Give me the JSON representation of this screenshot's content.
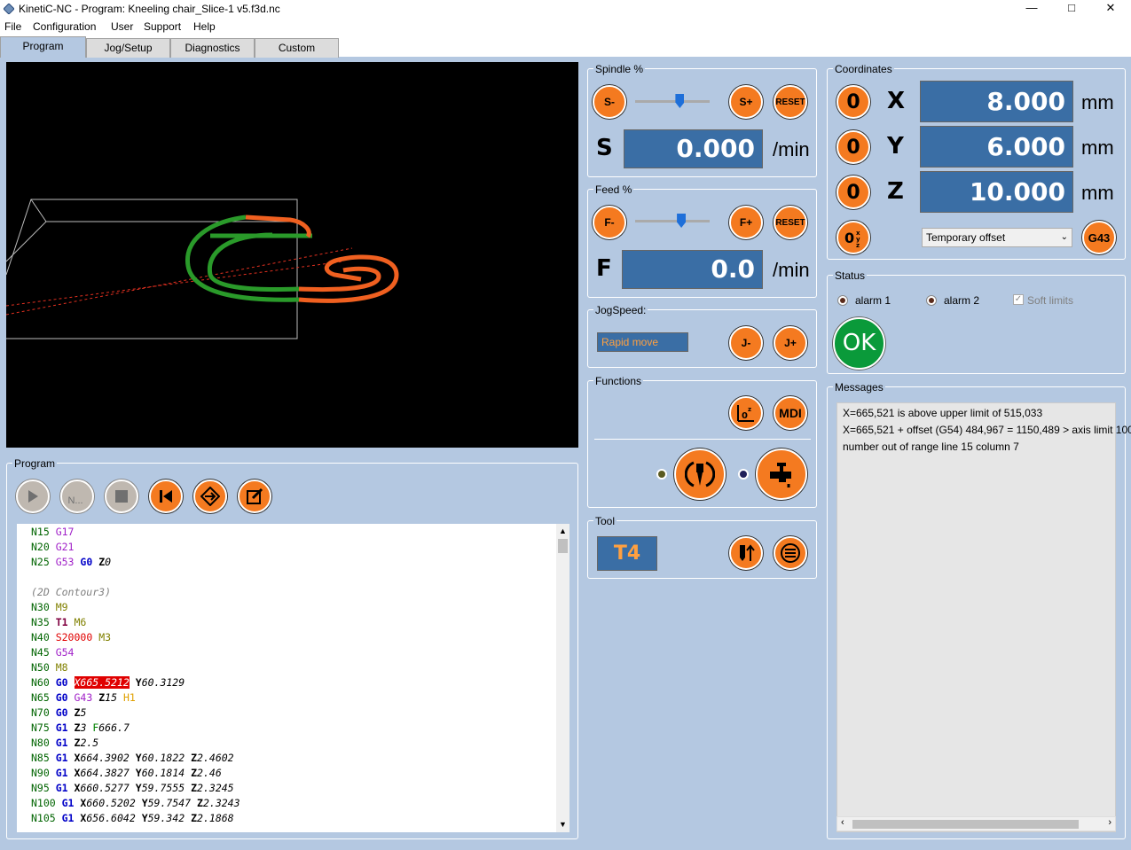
{
  "window": {
    "title": "KinetiC-NC - Program: Kneeling chair_Slice-1 v5.f3d.nc",
    "minimize": "—",
    "maximize": "□",
    "close": "✕"
  },
  "menu": [
    "File",
    "Configuration",
    "User",
    "Support",
    "Help"
  ],
  "tabs": [
    "Program",
    "Jog/Setup",
    "Diagnostics",
    "Custom"
  ],
  "spindle": {
    "label": "Spindle %",
    "minus": "S-",
    "plus": "S+",
    "reset": "RESET",
    "letter": "S",
    "value": "0.000",
    "unit": "/min",
    "slider_fraction": 0.6
  },
  "feed": {
    "label": "Feed %",
    "minus": "F-",
    "plus": "F+",
    "reset": "RESET",
    "letter": "F",
    "value": "0.0",
    "unit": "/min",
    "slider_fraction": 0.62
  },
  "jog": {
    "label": "JogSpeed:",
    "mode": "Rapid move",
    "minus": "J-",
    "plus": "J+"
  },
  "functions": {
    "label": "Functions",
    "mdi": "MDI"
  },
  "tool": {
    "label": "Tool",
    "value": "T4"
  },
  "coordinates": {
    "label": "Coordinates",
    "zero": "0",
    "axes": [
      {
        "name": "X",
        "value": "8.000",
        "unit": "mm"
      },
      {
        "name": "Y",
        "value": "6.000",
        "unit": "mm"
      },
      {
        "name": "Z",
        "value": "10.000",
        "unit": "mm"
      }
    ],
    "offset_select": "Temporary offset",
    "g43": "G43"
  },
  "status": {
    "label": "Status",
    "alarm1": "alarm 1",
    "alarm2": "alarm 2",
    "soft_limits": "Soft limits",
    "ok": "OK"
  },
  "messages": {
    "label": "Messages",
    "lines": [
      "X=665,521 is above upper limit of 515,033",
      "X=665,521 + offset (G54) 484,967 = 1150,489 > axis limit 100",
      "number out of range line 15 column 7"
    ]
  },
  "program": {
    "label": "Program",
    "next_label": "N..."
  },
  "code": [
    [
      [
        "N15 ",
        "n"
      ],
      [
        "G17",
        "g"
      ]
    ],
    [
      [
        "N20 ",
        "n"
      ],
      [
        "G21",
        "g"
      ]
    ],
    [
      [
        "N25 ",
        "n"
      ],
      [
        "G53",
        "g"
      ],
      [
        " ",
        "t"
      ],
      [
        "G0",
        "b"
      ],
      [
        " ",
        "t"
      ],
      [
        "Z",
        "k"
      ],
      [
        "0",
        "i"
      ]
    ],
    [],
    [
      [
        "(2D Contour3)",
        "c"
      ]
    ],
    [
      [
        "N30 ",
        "n"
      ],
      [
        "M9",
        "m"
      ]
    ],
    [
      [
        "N35 ",
        "n"
      ],
      [
        "T1",
        "r"
      ],
      [
        " ",
        "t"
      ],
      [
        "M6",
        "m"
      ]
    ],
    [
      [
        "N40 ",
        "n"
      ],
      [
        "S20000",
        "s"
      ],
      [
        " ",
        "t"
      ],
      [
        "M3",
        "m"
      ]
    ],
    [
      [
        "N45 ",
        "n"
      ],
      [
        "G54",
        "g"
      ]
    ],
    [
      [
        "N50 ",
        "n"
      ],
      [
        "M8",
        "m"
      ]
    ],
    [
      [
        "N60 ",
        "n"
      ],
      [
        "G0",
        "b"
      ],
      [
        " ",
        "t"
      ],
      [
        "X665.5212",
        "e"
      ],
      [
        " ",
        "t"
      ],
      [
        "Y",
        "k"
      ],
      [
        "60.3129",
        "i"
      ]
    ],
    [
      [
        "N65 ",
        "n"
      ],
      [
        "G0",
        "b"
      ],
      [
        " ",
        "t"
      ],
      [
        "G43",
        "g"
      ],
      [
        " ",
        "t"
      ],
      [
        "Z",
        "k"
      ],
      [
        "15",
        "i"
      ],
      [
        " ",
        "t"
      ],
      [
        "H1",
        "h"
      ]
    ],
    [
      [
        "N70 ",
        "n"
      ],
      [
        "G0",
        "b"
      ],
      [
        " ",
        "t"
      ],
      [
        "Z",
        "k"
      ],
      [
        "5",
        "i"
      ]
    ],
    [
      [
        "N75 ",
        "n"
      ],
      [
        "G1",
        "b"
      ],
      [
        " ",
        "t"
      ],
      [
        "Z",
        "k"
      ],
      [
        "3",
        "i"
      ],
      [
        " ",
        "t"
      ],
      [
        "F",
        "f"
      ],
      [
        "666.7",
        "i"
      ]
    ],
    [
      [
        "N80 ",
        "n"
      ],
      [
        "G1",
        "b"
      ],
      [
        " ",
        "t"
      ],
      [
        "Z",
        "k"
      ],
      [
        "2.5",
        "i"
      ]
    ],
    [
      [
        "N85 ",
        "n"
      ],
      [
        "G1",
        "b"
      ],
      [
        " ",
        "t"
      ],
      [
        "X",
        "k"
      ],
      [
        "664.3902",
        "i"
      ],
      [
        " ",
        "t"
      ],
      [
        "Y",
        "k"
      ],
      [
        "60.1822",
        "i"
      ],
      [
        " ",
        "t"
      ],
      [
        "Z",
        "k"
      ],
      [
        "2.4602",
        "i"
      ]
    ],
    [
      [
        "N90 ",
        "n"
      ],
      [
        "G1",
        "b"
      ],
      [
        " ",
        "t"
      ],
      [
        "X",
        "k"
      ],
      [
        "664.3827",
        "i"
      ],
      [
        " ",
        "t"
      ],
      [
        "Y",
        "k"
      ],
      [
        "60.1814",
        "i"
      ],
      [
        " ",
        "t"
      ],
      [
        "Z",
        "k"
      ],
      [
        "2.46",
        "i"
      ]
    ],
    [
      [
        "N95 ",
        "n"
      ],
      [
        "G1",
        "b"
      ],
      [
        " ",
        "t"
      ],
      [
        "X",
        "k"
      ],
      [
        "660.5277",
        "i"
      ],
      [
        " ",
        "t"
      ],
      [
        "Y",
        "k"
      ],
      [
        "59.7555",
        "i"
      ],
      [
        " ",
        "t"
      ],
      [
        "Z",
        "k"
      ],
      [
        "2.3245",
        "i"
      ]
    ],
    [
      [
        "N100 ",
        "n"
      ],
      [
        "G1",
        "b"
      ],
      [
        " ",
        "t"
      ],
      [
        "X",
        "k"
      ],
      [
        "660.5202",
        "i"
      ],
      [
        " ",
        "t"
      ],
      [
        "Y",
        "k"
      ],
      [
        "59.7547",
        "i"
      ],
      [
        " ",
        "t"
      ],
      [
        "Z",
        "k"
      ],
      [
        "2.3243",
        "i"
      ]
    ],
    [
      [
        "N105 ",
        "n"
      ],
      [
        "G1",
        "b"
      ],
      [
        " ",
        "t"
      ],
      [
        "X",
        "k"
      ],
      [
        "656.6042",
        "i"
      ],
      [
        " ",
        "t"
      ],
      [
        "Y",
        "k"
      ],
      [
        "59.342",
        "i"
      ],
      [
        " ",
        "t"
      ],
      [
        "Z",
        "k"
      ],
      [
        "2.1868",
        "i"
      ]
    ]
  ],
  "colors": {
    "n": "#006400",
    "g": "#a020c8",
    "b": "#0000c8",
    "k": "#000000",
    "i": "#000000",
    "c": "#808080",
    "m": "#808000",
    "r": "#800040",
    "s": "#e00000",
    "h": "#e0a000",
    "f": "#008000",
    "t": "#000000",
    "e": "#ffffff"
  }
}
